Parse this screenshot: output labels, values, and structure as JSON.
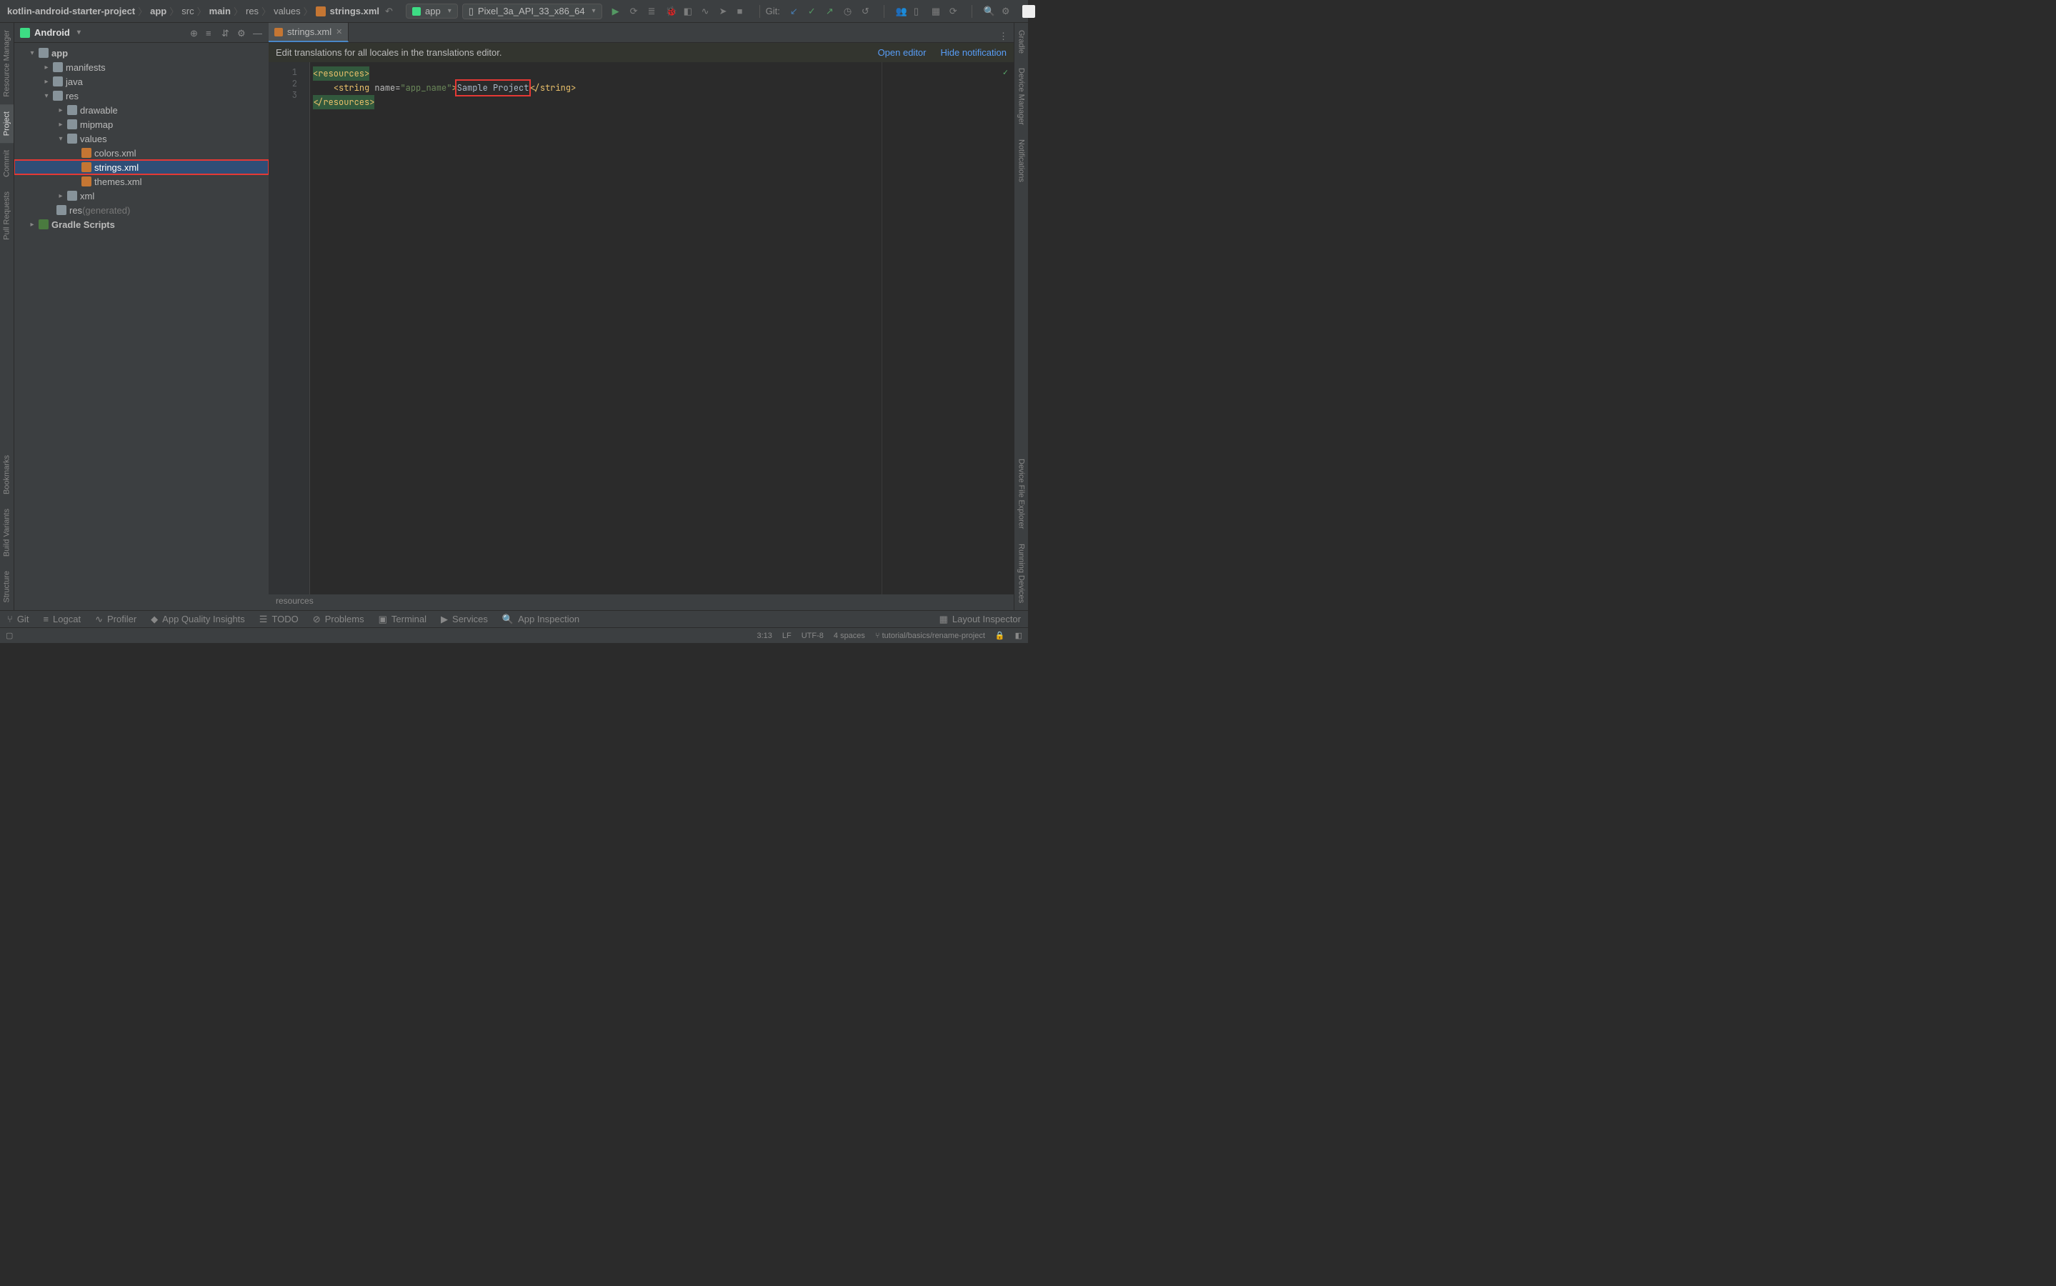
{
  "breadcrumb": {
    "project": "kotlin-android-starter-project",
    "module": "app",
    "src": "src",
    "main": "main",
    "res": "res",
    "values": "values",
    "file": "strings.xml"
  },
  "runConfig": "app",
  "deviceSelect": "Pixel_3a_API_33_x86_64",
  "gitLabel": "Git:",
  "projectPanel": {
    "title": "Android"
  },
  "tree": {
    "app": "app",
    "manifests": "manifests",
    "java": "java",
    "res": "res",
    "drawable": "drawable",
    "mipmap": "mipmap",
    "values": "values",
    "colors": "colors.xml",
    "strings": "strings.xml",
    "themes": "themes.xml",
    "xml": "xml",
    "res_gen": "res",
    "res_gen_suffix": " (generated)",
    "gradle": "Gradle Scripts"
  },
  "tab": "strings.xml",
  "banner": {
    "msg": "Edit translations for all locales in the translations editor.",
    "open": "Open editor",
    "hide": "Hide notification"
  },
  "code": {
    "line1_tag": "<resources>",
    "line2_indent": "    ",
    "line2_tag_open": "<string",
    "line2_attr_name": " name",
    "line2_eq": "=",
    "line2_attr_val": "\"app_name\"",
    "line2_close": ">",
    "line2_text": "Sample Project",
    "line2_end": "</string>",
    "line3_tag": "</resources>",
    "nums": [
      "1",
      "2",
      "3"
    ]
  },
  "editor_bc": "resources",
  "bottomTabs": {
    "git": "Git",
    "logcat": "Logcat",
    "profiler": "Profiler",
    "insights": "App Quality Insights",
    "todo": "TODO",
    "problems": "Problems",
    "terminal": "Terminal",
    "services": "Services",
    "inspection": "App Inspection",
    "layout": "Layout Inspector"
  },
  "leftTabs": {
    "resource": "Resource Manager",
    "project": "Project",
    "commit": "Commit",
    "pull": "Pull Requests",
    "bookmarks": "Bookmarks",
    "variants": "Build Variants",
    "structure": "Structure"
  },
  "rightTabs": {
    "gradle": "Gradle",
    "device_mgr": "Device Manager",
    "notifications": "Notifications",
    "file_explorer": "Device File Explorer",
    "running": "Running Devices"
  },
  "status": {
    "pos": "3:13",
    "lineend": "LF",
    "encoding": "UTF-8",
    "indent": "4 spaces",
    "tutorial": "tutorial/basics/rename-project"
  }
}
